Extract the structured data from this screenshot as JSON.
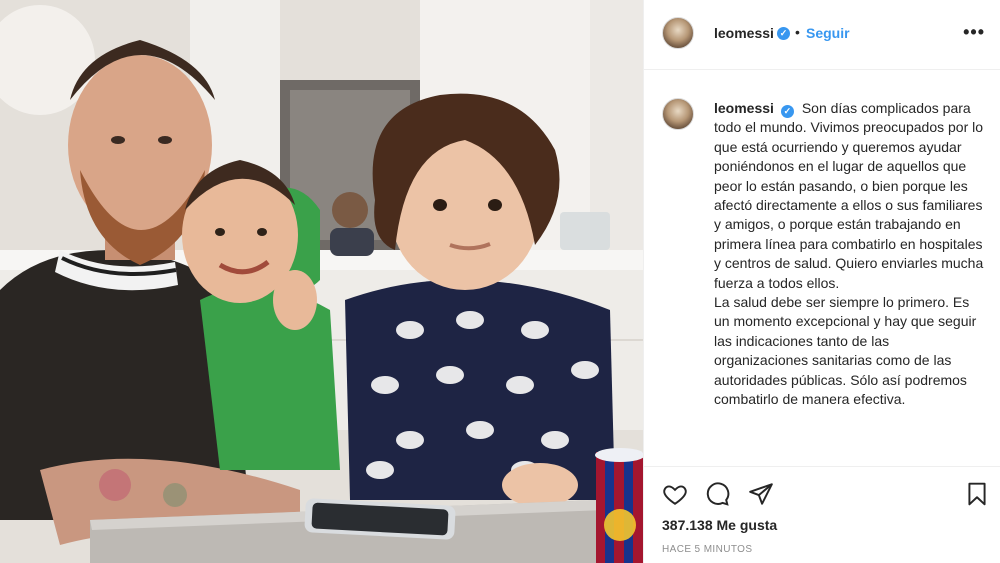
{
  "post": {
    "image_alt": "Photo of a man with two children at a table"
  },
  "header": {
    "username": "leomessi",
    "verified_mark": "✓",
    "separator": "•",
    "follow_label": "Seguir",
    "more_label": "•••"
  },
  "caption": {
    "username": "leomessi",
    "verified_mark": "✓",
    "paragraph_1": "Son días complicados para todo el mundo. Vivimos preocupados por lo que está ocurriendo y queremos ayudar poniéndonos en el lugar de aquellos que peor lo están pasando, o bien porque les afectó directamente a ellos o sus familiares y amigos, o porque están trabajando en primera línea para combatirlo en hospitales y centros de salud. Quiero enviarles mucha fuerza a todos ellos.",
    "paragraph_2": "La salud debe ser siempre lo primero. Es un momento excepcional y hay que seguir las indicaciones tanto de las organizaciones sanitarias como de las autoridades públicas. Sólo así podremos combatirlo de manera efectiva."
  },
  "actions": {
    "like_icon": "heart-icon",
    "comment_icon": "comment-bubble-icon",
    "share_icon": "paper-plane-icon",
    "save_icon": "bookmark-icon"
  },
  "stats": {
    "likes": "387.138 Me gusta",
    "time_ago": "HACE 5 MINUTOS"
  },
  "colors": {
    "link_blue": "#3897f0",
    "text": "#262626",
    "muted": "#8e8e8e",
    "border": "#efefef"
  }
}
